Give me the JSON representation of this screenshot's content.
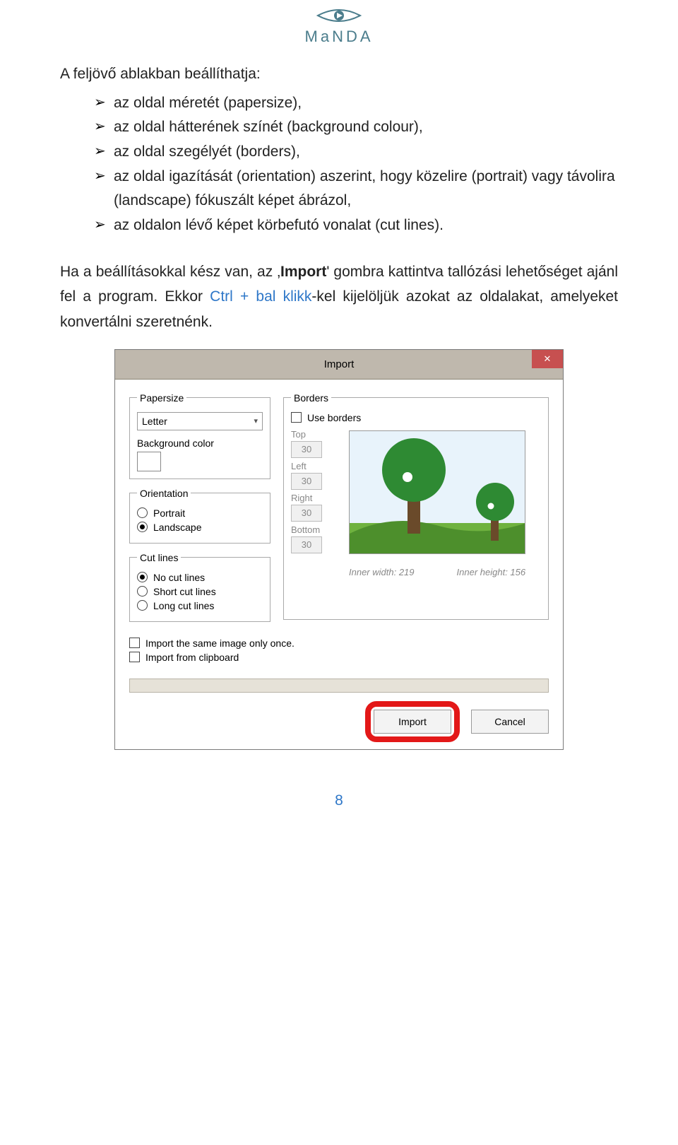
{
  "logo": {
    "text": "MaNDA"
  },
  "intro": "A feljövő ablakban beállíthatja:",
  "bullets": [
    "az oldal méretét (papersize),",
    "az oldal hátterének színét (background colour),",
    "az oldal szegélyét (borders),",
    "az oldal igazítását (orientation) aszerint, hogy közelire (portrait) vagy távolira (landscape) fókuszált képet ábrázol,",
    "az oldalon lévő képet körbefutó vonalat (cut lines)."
  ],
  "para": {
    "pre": "Ha a beállításokkal kész van, az ‚",
    "bold": "Import",
    "mid": "' gombra kattintva tallózási lehetőséget ajánl fel a program. Ekkor ",
    "blue": "Ctrl + bal klikk",
    "post": "-kel kijelöljük azokat az oldalakat, amelyeket konvertálni szeretnénk."
  },
  "dialog": {
    "title": "Import",
    "closeGlyph": "✕",
    "papersize": {
      "legend": "Papersize",
      "selected": "Letter",
      "bgcolor_label": "Background color"
    },
    "orientation": {
      "legend": "Orientation",
      "portrait": "Portrait",
      "landscape": "Landscape",
      "selected": "landscape"
    },
    "cutlines": {
      "legend": "Cut lines",
      "options": {
        "none": "No cut lines",
        "short": "Short cut lines",
        "long": "Long cut lines"
      },
      "selected": "none"
    },
    "borders": {
      "legend": "Borders",
      "use_label": "Use borders",
      "top_label": "Top",
      "top_val": "30",
      "left_label": "Left",
      "left_val": "30",
      "right_label": "Right",
      "right_val": "30",
      "bottom_label": "Bottom",
      "bottom_val": "30",
      "inner_w_label": "Inner width: ",
      "inner_w_val": "219",
      "inner_h_label": "Inner height: ",
      "inner_h_val": "156"
    },
    "extra": {
      "same_image": "Import the same image only once.",
      "clipboard": "Import from clipboard"
    },
    "buttons": {
      "import": "Import",
      "cancel": "Cancel"
    }
  },
  "page_number": "8"
}
